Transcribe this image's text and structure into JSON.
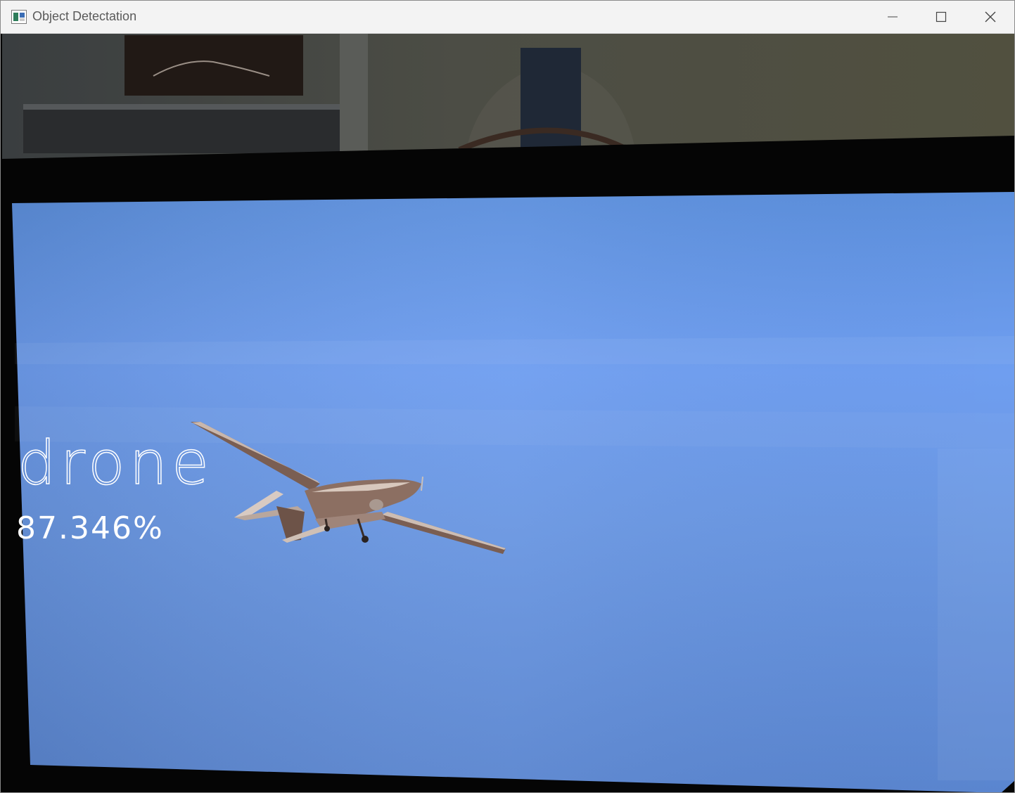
{
  "window": {
    "title": "Object Detectation",
    "icon": "app-window-icon",
    "controls": {
      "minimize_icon": "minimize-icon",
      "maximize_icon": "maximize-icon",
      "close_icon": "close-icon"
    }
  },
  "detection": {
    "label": "drone",
    "confidence": "87.346%"
  },
  "colors": {
    "titlebar_bg": "#f3f3f3",
    "title_text": "#5a5a5a",
    "sky": "#6a9ae8",
    "overlay_text": "#ffffff"
  }
}
